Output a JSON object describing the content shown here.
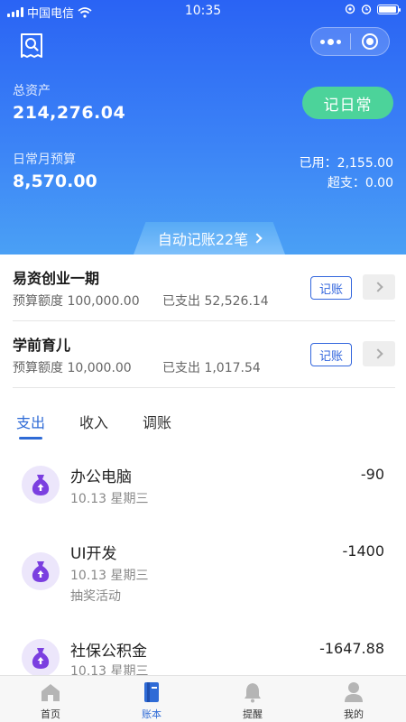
{
  "status_bar": {
    "carrier": "中国电信",
    "time": "10:35"
  },
  "header": {
    "total_assets_label": "总资产",
    "total_assets_value": "214,276.04",
    "daily_button": "记日常",
    "monthly_budget_label": "日常月预算",
    "monthly_budget_value": "8,570.00",
    "used_label": "已用：",
    "used_value": "2,155.00",
    "over_label": "超支：",
    "over_value": "0.00",
    "auto_record": "自动记账22笔"
  },
  "projects": [
    {
      "name": "易资创业一期",
      "quota_label": "预算额度",
      "quota_value": "100,000.00",
      "spent_label": "已支出",
      "spent_value": "52,526.14",
      "record_button": "记账"
    },
    {
      "name": "学前育儿",
      "quota_label": "预算额度",
      "quota_value": "10,000.00",
      "spent_label": "已支出",
      "spent_value": "1,017.54",
      "record_button": "记账"
    }
  ],
  "tabs": [
    {
      "label": "支出",
      "active": true
    },
    {
      "label": "收入",
      "active": false
    },
    {
      "label": "调账",
      "active": false
    }
  ],
  "transactions": [
    {
      "title": "办公电脑",
      "date": "10.13 星期三",
      "note": "",
      "amount": "-90",
      "icon": "money-bag-icon"
    },
    {
      "title": "UI开发",
      "date": "10.13 星期三",
      "note": "抽奖活动",
      "amount": "-1400",
      "icon": "money-bag-icon"
    },
    {
      "title": "社保公积金",
      "date": "10.13 星期三",
      "note": "",
      "amount": "-1647.88",
      "icon": "money-bag-icon"
    }
  ],
  "bottom_nav": [
    {
      "label": "首页",
      "icon": "home-icon",
      "active": false
    },
    {
      "label": "账本",
      "icon": "ledger-icon",
      "active": true
    },
    {
      "label": "提醒",
      "icon": "bell-icon",
      "active": false
    },
    {
      "label": "我的",
      "icon": "user-icon",
      "active": false
    }
  ],
  "colors": {
    "header_top": "#2a63f4",
    "header_bottom": "#4aa0f5",
    "daily_button": "#4cd39a",
    "accent": "#2f6bd6",
    "icon_bg": "#ece6fb",
    "icon_fg": "#7b3fe0"
  }
}
